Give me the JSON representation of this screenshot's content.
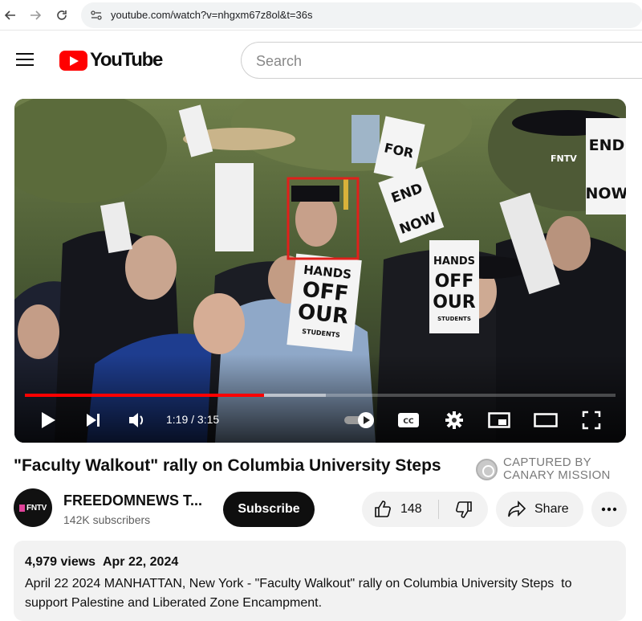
{
  "browser": {
    "url": "youtube.com/watch?v=nhgxm67z8ol&t=36s",
    "back_icon": "arrow-left-icon",
    "forward_icon": "arrow-right-icon",
    "reload_icon": "reload-icon"
  },
  "header": {
    "logo_text": "YouTube",
    "search_placeholder": "Search"
  },
  "player": {
    "current_time": "1:19",
    "separator": " / ",
    "duration": "3:15",
    "played_fraction": 0.405,
    "buffered_fraction": 0.51,
    "signs": {
      "hands_off": [
        "HANDS",
        "OFF",
        "OUR",
        "STUDENTS"
      ],
      "end_now": [
        "END",
        "NOW"
      ],
      "for": "FOR",
      "fntv_tag": "FNTV"
    }
  },
  "video": {
    "title": "\"Faculty Walkout\" rally on Columbia University Steps",
    "watermark_line1": "CAPTURED BY",
    "watermark_line2": "CANARY MISSION"
  },
  "channel": {
    "avatar_text": "FNTV",
    "name": "FREEDOMNEWS T...",
    "subscribers": "142K subscribers",
    "subscribe_label": "Subscribe"
  },
  "actions": {
    "like_count": "148",
    "share_label": "Share"
  },
  "description": {
    "views": "4,979 views",
    "date": "Apr 22, 2024",
    "text": "April 22 2024 MANHATTAN, New York - \"Faculty Walkout\" rally on Columbia University Steps  to support Palestine and Liberated Zone Encampment."
  },
  "colors": {
    "brand_red": "#ff0000",
    "highlight_box": "#e0201b",
    "subscribe_bg": "#0f0f0f",
    "pill_bg": "#f2f2f2"
  }
}
